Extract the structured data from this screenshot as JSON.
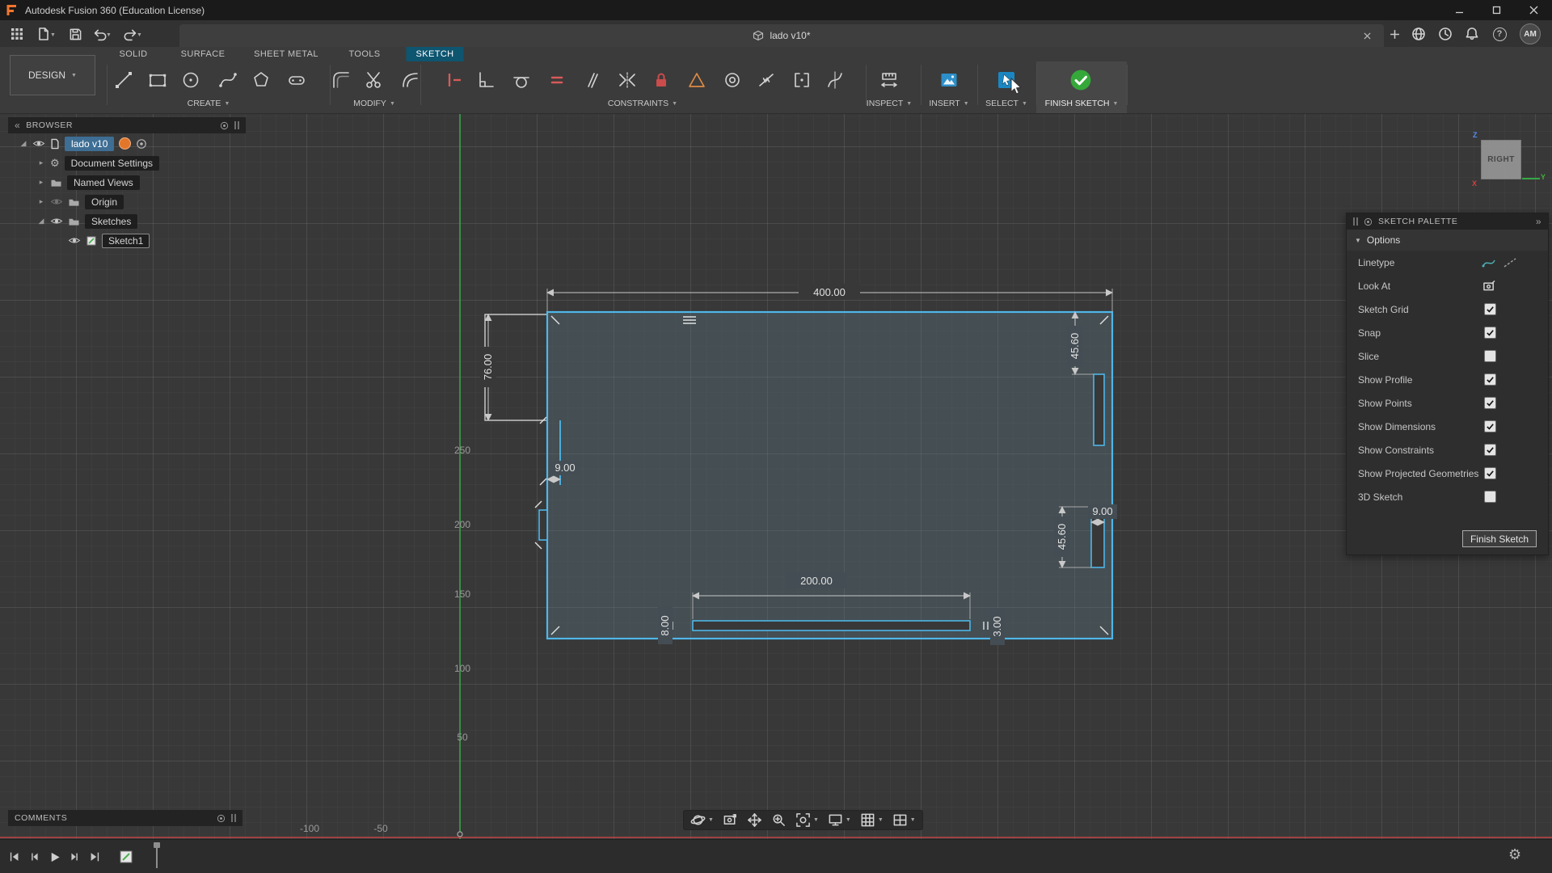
{
  "title_bar": {
    "app_title": "Autodesk Fusion 360 (Education License)"
  },
  "tab_bar": {
    "document_title": "lado v10*",
    "avatar_initials": "AM"
  },
  "ribbon": {
    "design_label": "DESIGN",
    "tabs": [
      "SOLID",
      "SURFACE",
      "SHEET METAL",
      "TOOLS",
      "SKETCH"
    ],
    "active_tab": "SKETCH",
    "groups": [
      "CREATE",
      "MODIFY",
      "CONSTRAINTS",
      "INSPECT",
      "INSERT",
      "SELECT",
      "FINISH SKETCH"
    ]
  },
  "browser": {
    "header": "BROWSER",
    "items": [
      {
        "label": "lado v10",
        "selected": true
      },
      {
        "label": "Document Settings",
        "selected": false
      },
      {
        "label": "Named Views",
        "selected": false
      },
      {
        "label": "Origin",
        "selected": false
      },
      {
        "label": "Sketches",
        "selected": false
      },
      {
        "label": "Sketch1",
        "selected": false
      }
    ]
  },
  "comments": {
    "header": "COMMENTS"
  },
  "viewcube": {
    "face": "RIGHT",
    "axes": {
      "x": "X",
      "y": "Y",
      "z": "Z"
    }
  },
  "sketch_palette": {
    "header": "SKETCH PALETTE",
    "section": "Options",
    "options": [
      {
        "label": "Linetype",
        "checked": null
      },
      {
        "label": "Look At",
        "checked": null
      },
      {
        "label": "Sketch Grid",
        "checked": true
      },
      {
        "label": "Snap",
        "checked": true
      },
      {
        "label": "Slice",
        "checked": false
      },
      {
        "label": "Show Profile",
        "checked": true
      },
      {
        "label": "Show Points",
        "checked": true
      },
      {
        "label": "Show Dimensions",
        "checked": true
      },
      {
        "label": "Show Constraints",
        "checked": true
      },
      {
        "label": "Show Projected Geometries",
        "checked": true
      },
      {
        "label": "3D Sketch",
        "checked": false
      }
    ],
    "finish_button": "Finish Sketch"
  },
  "canvas": {
    "dimensions": {
      "top_width": "400.00",
      "left_height": "76.00",
      "left_offset": "9.00",
      "right_top_height": "45.60",
      "right_slot_height": "45.60",
      "right_slot_width": "9.00",
      "bottom_slot_length": "200.00",
      "bottom_left_height": "8.00",
      "bottom_right_height": "3.00"
    },
    "y_axis_labels": [
      "250",
      "200",
      "150",
      "100",
      "50"
    ],
    "x_axis_labels": [
      "-100",
      "-50"
    ]
  },
  "colors": {
    "accent_blue": "#0696D7",
    "sketch_line": "#4FB6E8",
    "axis_green": "#35A845",
    "axis_red": "#BE4343",
    "finish_green": "#35A83A"
  }
}
